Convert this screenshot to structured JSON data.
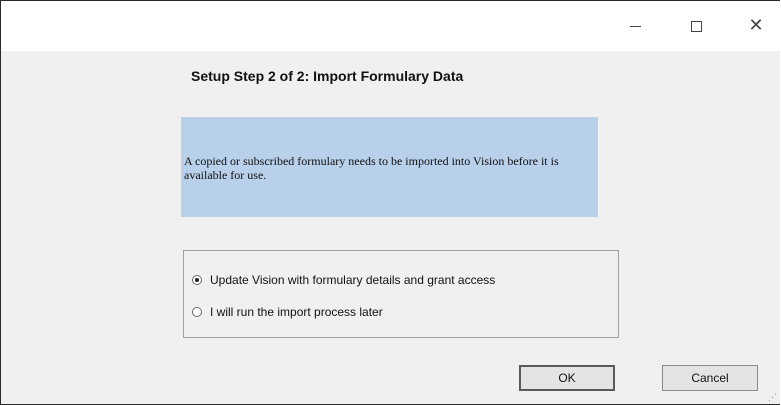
{
  "window": {
    "title_controls": {
      "minimize": "—",
      "maximize": "☐",
      "close": "✕"
    }
  },
  "dialog": {
    "heading": "Setup Step 2 of 2: Import Formulary Data",
    "info_text": "A copied or subscribed formulary needs to be imported into Vision before it is available for use.",
    "options": [
      {
        "label": "Update Vision with formulary details and grant access",
        "selected": true
      },
      {
        "label": "I will run the import process later",
        "selected": false
      }
    ],
    "ok_label": "OK",
    "cancel_label": "Cancel"
  },
  "colors": {
    "info_background": "#b9d0ea",
    "dialog_background": "#f0f0f0"
  }
}
